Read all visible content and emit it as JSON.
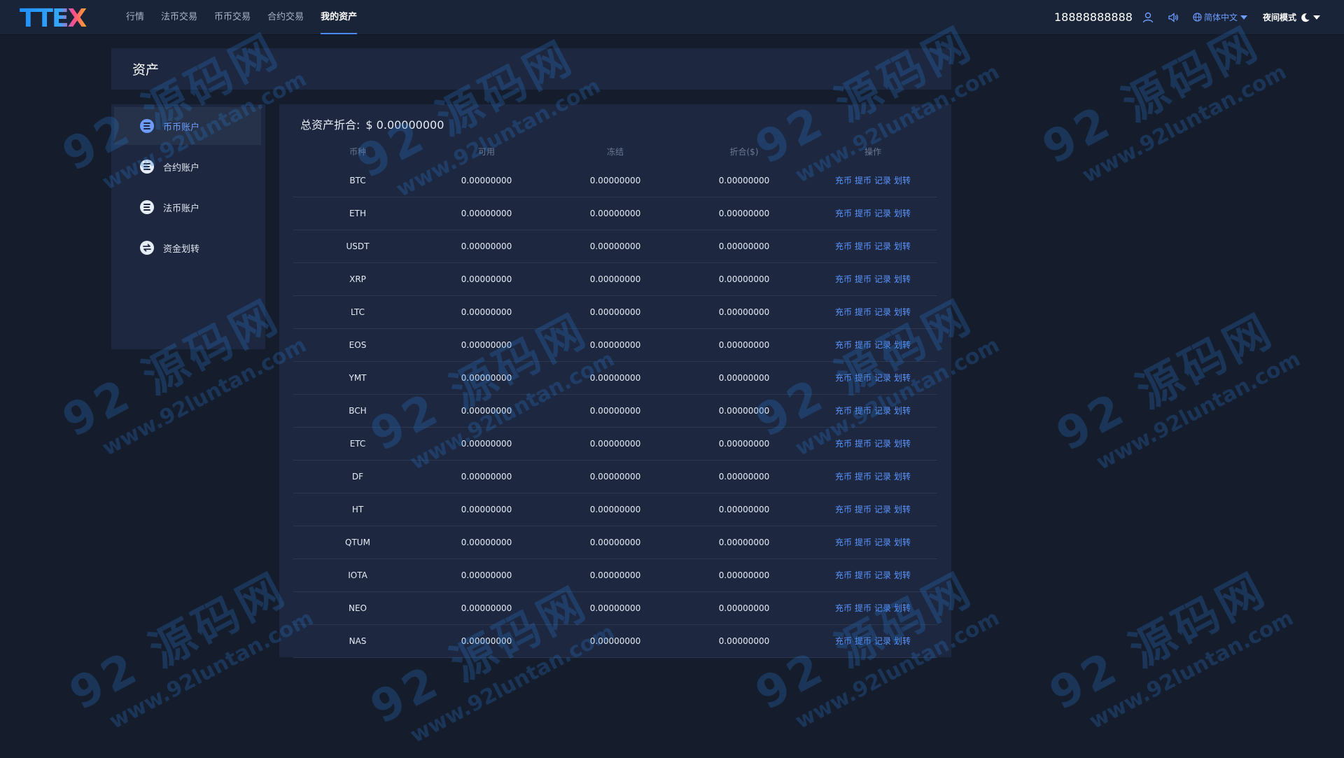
{
  "logo": {
    "text": "TTEX"
  },
  "nav": [
    {
      "label": "行情",
      "active": false
    },
    {
      "label": "法币交易",
      "active": false
    },
    {
      "label": "币币交易",
      "active": false
    },
    {
      "label": "合约交易",
      "active": false
    },
    {
      "label": "我的资产",
      "active": true
    }
  ],
  "top_right": {
    "phone": "18888888888",
    "user_icon": "user-icon",
    "sound_icon": "speaker-icon",
    "language": "简体中文",
    "night_mode": "夜间模式"
  },
  "page": {
    "title": "资产"
  },
  "sidebar": {
    "items": [
      {
        "label": "币币账户",
        "icon": "coin-account-icon",
        "active": true
      },
      {
        "label": "合约账户",
        "icon": "contract-account-icon",
        "active": false
      },
      {
        "label": "法币账户",
        "icon": "fiat-account-icon",
        "active": false
      },
      {
        "label": "资金划转",
        "icon": "transfer-icon",
        "active": false
      }
    ]
  },
  "summary": {
    "label": "总资产折合:",
    "value": "$ 0.00000000"
  },
  "table": {
    "columns": [
      "币种",
      "可用",
      "冻结",
      "折合($)",
      "操作"
    ],
    "actions": [
      "充币",
      "提币",
      "记录",
      "划转"
    ],
    "rows": [
      [
        "BTC",
        "0.00000000",
        "0.00000000",
        "0.00000000"
      ],
      [
        "ETH",
        "0.00000000",
        "0.00000000",
        "0.00000000"
      ],
      [
        "USDT",
        "0.00000000",
        "0.00000000",
        "0.00000000"
      ],
      [
        "XRP",
        "0.00000000",
        "0.00000000",
        "0.00000000"
      ],
      [
        "LTC",
        "0.00000000",
        "0.00000000",
        "0.00000000"
      ],
      [
        "EOS",
        "0.00000000",
        "0.00000000",
        "0.00000000"
      ],
      [
        "YMT",
        "0.00000000",
        "0.00000000",
        "0.00000000"
      ],
      [
        "BCH",
        "0.00000000",
        "0.00000000",
        "0.00000000"
      ],
      [
        "ETC",
        "0.00000000",
        "0.00000000",
        "0.00000000"
      ],
      [
        "DF",
        "0.00000000",
        "0.00000000",
        "0.00000000"
      ],
      [
        "HT",
        "0.00000000",
        "0.00000000",
        "0.00000000"
      ],
      [
        "QTUM",
        "0.00000000",
        "0.00000000",
        "0.00000000"
      ],
      [
        "IOTA",
        "0.00000000",
        "0.00000000",
        "0.00000000"
      ],
      [
        "NEO",
        "0.00000000",
        "0.00000000",
        "0.00000000"
      ],
      [
        "NAS",
        "0.00000000",
        "0.00000000",
        "0.00000000"
      ]
    ]
  },
  "watermark": {
    "main": "92 源码网",
    "sub": "www.92luntan.com"
  },
  "colors": {
    "accent": "#4a8cff",
    "link": "#5b95ff",
    "background": "#151d2c",
    "panel": "#1d2840"
  }
}
